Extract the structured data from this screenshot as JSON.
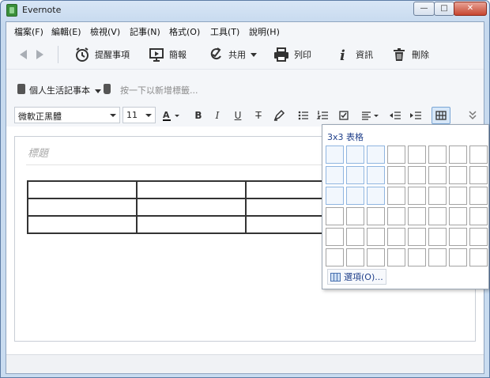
{
  "window": {
    "title": "Evernote",
    "controls": {
      "minimize": "—",
      "maximize": "□",
      "close": "✕"
    }
  },
  "menu": [
    {
      "label": "檔案(F)"
    },
    {
      "label": "編輯(E)"
    },
    {
      "label": "檢視(V)"
    },
    {
      "label": "記事(N)"
    },
    {
      "label": "格式(O)"
    },
    {
      "label": "工具(T)"
    },
    {
      "label": "說明(H)"
    }
  ],
  "toolbar": {
    "reminder": "提醒事項",
    "present": "簡報",
    "share": "共用",
    "print": "列印",
    "info": "資訊",
    "delete": "刪除"
  },
  "note": {
    "notebook": "個人生活記事本",
    "tag_hint": "按一下以新增標籤...",
    "title_placeholder": "標題"
  },
  "format": {
    "font": "微軟正黑體",
    "size": "11",
    "bold": "B",
    "italic": "I",
    "underline": "U",
    "strike": "T"
  },
  "table_picker": {
    "label": "3x3 表格",
    "rows": 6,
    "cols": 8,
    "selected_rows": 3,
    "selected_cols": 3,
    "options": "選項(O)..."
  },
  "table": {
    "rows": 3,
    "cols": 3
  }
}
